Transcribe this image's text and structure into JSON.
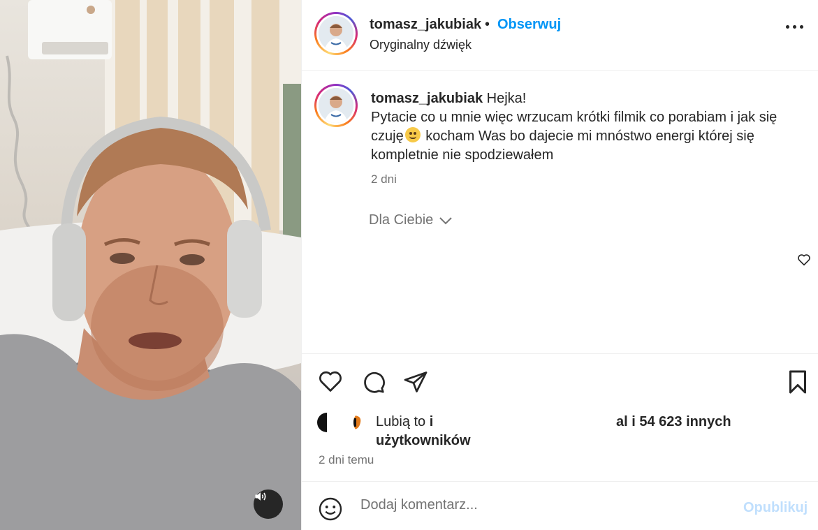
{
  "header": {
    "username": "tomasz_jakubiak",
    "separator": "•",
    "follow_label": "Obserwuj",
    "audio_label": "Oryginalny dźwięk",
    "more_icon": "more-horizontal-icon"
  },
  "caption": {
    "username": "tomasz_jakubiak",
    "text_part1": "Hejka!",
    "text_part2": "Pytacie co u mnie więc wrzucam krótki filmik co porabiam i jak się czuję",
    "text_part3": " kocham Was bo dajecie mi mnóstwo energi której się kompletnie nie spodziewałem",
    "emoji": "smiling-face-emoji",
    "time": "2 dni"
  },
  "dla_ciebie": {
    "label": "Dla Ciebie"
  },
  "actions": {
    "like_icon": "heart-icon",
    "comment_icon": "comment-icon",
    "share_icon": "share-icon",
    "save_icon": "bookmark-icon"
  },
  "likes": {
    "prefix": "Lubią to ",
    "bold_i": "i",
    "line2": "użytkowników",
    "suffix": "al i 54 623 innych"
  },
  "post_time": "2 dni temu",
  "comment": {
    "placeholder": "Dodaj komentarz...",
    "publish_label": "Opublikuj",
    "emoji_icon": "emoji-icon"
  },
  "video": {
    "mute_icon": "speaker-icon"
  }
}
